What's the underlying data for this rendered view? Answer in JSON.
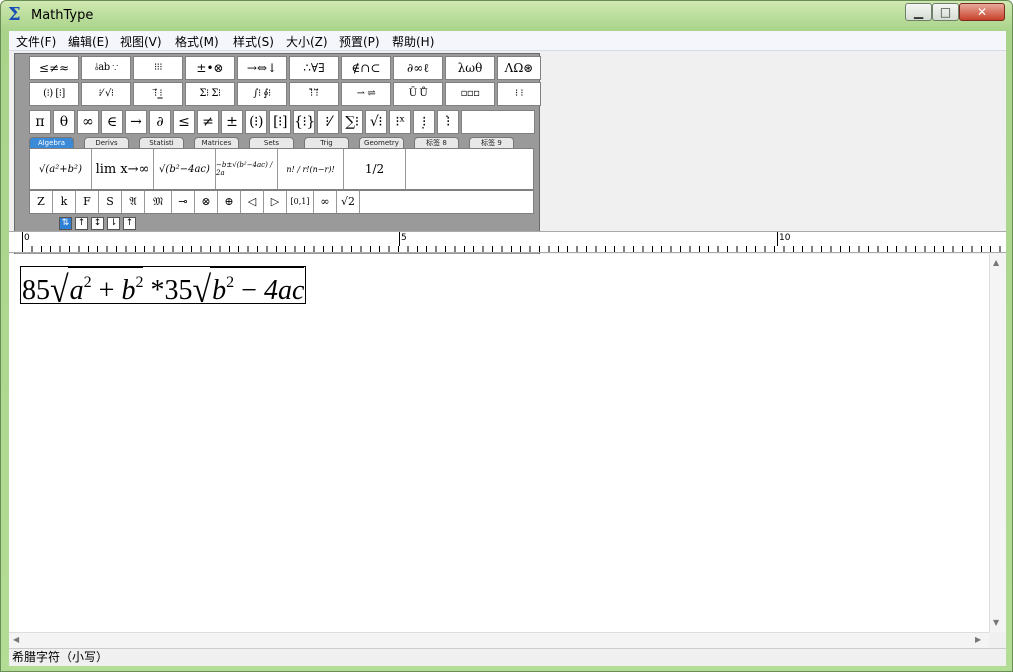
{
  "window": {
    "title": "MathType",
    "minimize": "▁",
    "maximize": "□",
    "close": "✕"
  },
  "menu": [
    "文件(F)",
    "编辑(E)",
    "视图(V)",
    "格式(M)",
    "样式(S)",
    "大小(Z)",
    "预置(P)",
    "帮助(H)"
  ],
  "palette_row1": [
    "≤≠≈",
    "⫰ab ∵",
    "⁝⁝⁝",
    "±•⊗",
    "→⇔↓",
    "∴∀∃",
    "∉∩⊂",
    "∂∞ℓ",
    "λωθ",
    "ΛΩ⊛"
  ],
  "palette_row2": [
    "(⁝) [⁝]",
    "⁝⁄ √⁝",
    "⁝⃗ ⁝̲",
    "Σ⁝ Σ⁝",
    "∫⁝ ∮⁝",
    "⁝̄ ⁝⃡",
    "⇀ ⇌",
    "Ū Ů",
    "▫▫▫",
    "⁝ ⁝"
  ],
  "palette_row3": [
    "π",
    "θ",
    "∞",
    "∈",
    "→",
    "∂",
    "≤",
    "≠",
    "±",
    "(⁝)",
    "[⁝]",
    "{⁝}",
    "⁝⁄",
    "∑⁝",
    "√⁝",
    "⁝ˣ",
    "⁝̣",
    "⁝̇"
  ],
  "tabs": [
    "Algebra",
    "Derivs",
    "Statisti",
    "Matrices",
    "Sets",
    "Trig",
    "Geometry",
    "标签 8",
    "标签 9"
  ],
  "templates": [
    "√(a²+b²)",
    "lim x→∞",
    "√(b²−4ac)",
    "−b±√(b²−4ac) / 2a",
    "n! / r!(n−r)!",
    "1/2"
  ],
  "row5": [
    "Z",
    "k",
    "F",
    "S",
    "𝔄",
    "𝔐",
    "⊸",
    "⊗",
    "⊕",
    "◁",
    "▷",
    "[0,1]",
    "∞",
    "√2"
  ],
  "nudge": [
    "⇅",
    "↑",
    "↕",
    "⇂",
    "↑"
  ],
  "ruler": {
    "labels": [
      "0",
      "5",
      "10"
    ]
  },
  "equation": {
    "coef1": "85",
    "a": "a",
    "exp1": "2",
    "plus": "+",
    "b1": "b",
    "exp2": "2",
    "times": "*",
    "coef2": "35",
    "b2": "b",
    "exp3": "2",
    "minus": "−",
    "term": "4ac"
  },
  "status": "希腊字符（小写）"
}
